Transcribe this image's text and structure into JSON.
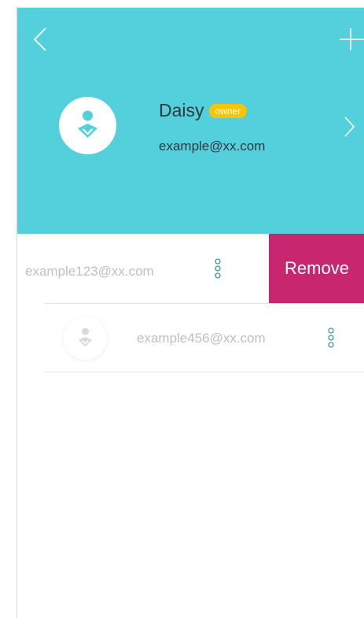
{
  "owner": {
    "name": "Daisy",
    "badge": "owner",
    "email": "example@xx.com"
  },
  "members": [
    {
      "email": "example123@xx.com",
      "action": "Remove"
    },
    {
      "email": "example456@xx.com"
    }
  ],
  "icons": {
    "back": "chevron-left-icon",
    "add": "plus-icon",
    "owner_avatar": "person-icon",
    "forward": "chevron-right-icon",
    "more": "more-vertical-icon"
  },
  "colors": {
    "header_bg": "#54d0dc",
    "badge_bg": "#f7c600",
    "remove_bg": "#c8266e",
    "more_icon": "#3a9aa6"
  }
}
